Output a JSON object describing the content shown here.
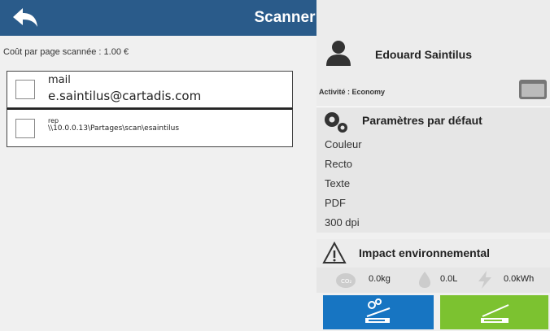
{
  "header": {
    "title": "Scanner"
  },
  "left": {
    "cost_label": "Coût par page scannée : 1.00 €",
    "destinations": [
      {
        "title": "mail",
        "value": "e.saintilus@cartadis.com"
      },
      {
        "title": "rep",
        "value": "\\\\10.0.0.13\\Partages\\scan\\esaintilus"
      }
    ]
  },
  "right": {
    "user_name": "Edouard Saintilus",
    "activity": "Activité : Economy",
    "params_title": "Paramètres par défaut",
    "params": [
      "Couleur",
      "Recto",
      "Texte",
      "PDF",
      "300 dpi"
    ],
    "impact_title": "Impact environnemental",
    "co2_label": "CO₂",
    "co2": "0.0kg",
    "water": "0.0L",
    "energy": "0.0kWh"
  },
  "colors": {
    "header": "#2a5b8a",
    "scan_settings_button": "#1775c2",
    "scan_button": "#7cc230"
  }
}
